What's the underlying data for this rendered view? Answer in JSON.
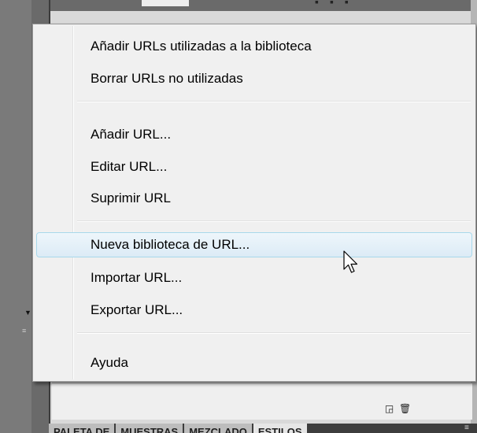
{
  "background": {
    "tabs": [
      {
        "label": "PALETA DE"
      },
      {
        "label": "MUESTRAS"
      },
      {
        "label": "MEZCLADO"
      },
      {
        "label": "ESTILOS"
      }
    ],
    "icons": {
      "new_item": "new-page-icon",
      "delete": "trash-icon"
    }
  },
  "context_menu": {
    "groups": [
      {
        "items": [
          {
            "label": "Añadir URLs utilizadas a la biblioteca"
          },
          {
            "label": "Borrar URLs no utilizadas"
          }
        ]
      },
      {
        "items": [
          {
            "label": "Añadir URL..."
          },
          {
            "label": "Editar URL..."
          },
          {
            "label": "Suprimir URL"
          }
        ]
      },
      {
        "items": [
          {
            "label": "Nueva biblioteca de URL...",
            "highlighted": true
          },
          {
            "label": "Importar URL..."
          },
          {
            "label": "Exportar URL..."
          }
        ]
      },
      {
        "items": [
          {
            "label": "Ayuda"
          }
        ]
      }
    ],
    "highlight_color": "#dcebf6",
    "highlight_border": "#a8d8eb"
  }
}
